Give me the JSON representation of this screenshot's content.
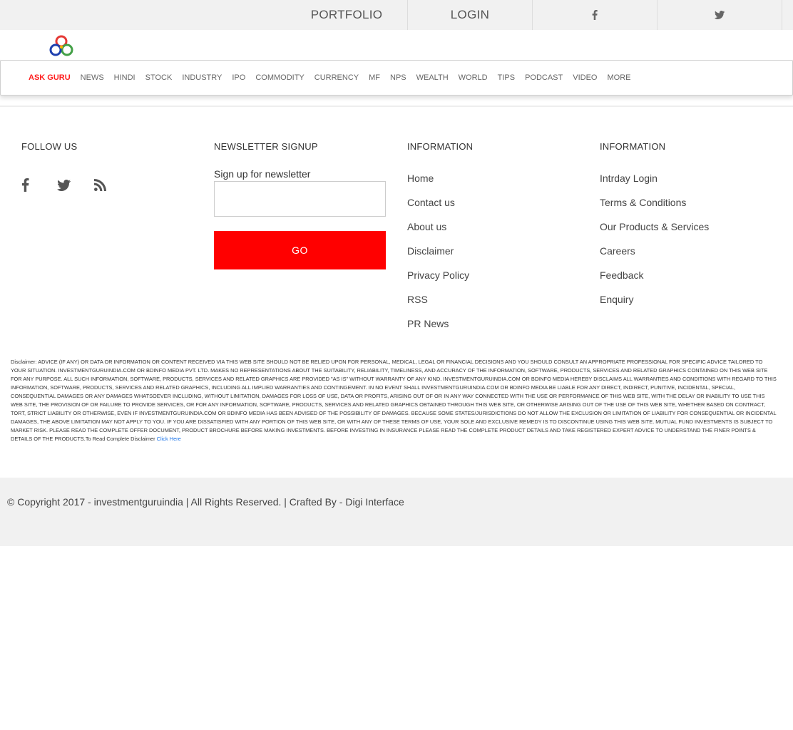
{
  "topbar": {
    "portfolio": "PORTFOLIO",
    "login": "LOGIN",
    "facebook_icon": "facebook-icon",
    "twitter_icon": "twitter-icon"
  },
  "nav": {
    "items": [
      "ASK GURU",
      "NEWS",
      "HINDI",
      "STOCK",
      "INDUSTRY",
      "IPO",
      "COMMODITY",
      "CURRENCY",
      "MF",
      "NPS",
      "WEALTH",
      "WORLD",
      "TIPS",
      "PODCAST",
      "VIDEO",
      "MORE"
    ],
    "active_color": "#ff1f1f"
  },
  "footer": {
    "follow": {
      "title": "FOLLOW US",
      "icons": [
        "facebook-icon",
        "twitter-icon",
        "rss-icon"
      ]
    },
    "newsletter": {
      "title": "NEWSLETTER SIGNUP",
      "label": "Sign up for newsletter",
      "input_value": "",
      "button": "GO",
      "button_color": "#ff0000"
    },
    "info1": {
      "title": "INFORMATION",
      "links": [
        "Home",
        "Contact us",
        "About us",
        "Disclaimer",
        "Privacy Policy",
        "RSS",
        "PR News"
      ]
    },
    "info2": {
      "title": "INFORMATION",
      "links": [
        "Intrday Login",
        "Terms & Conditions",
        "Our Products & Services",
        "Careers",
        "Feedback",
        "Enquiry"
      ]
    }
  },
  "disclaimer": {
    "text": "Disclaimer: ADVICE (IF ANY) OR DATA OR INFORMATION OR CONTENT RECEIVED VIA THIS WEB SITE SHOULD NOT BE RELIED UPON FOR PERSONAL, MEDICAL, LEGAL OR FINANCIAL DECISIONS AND YOU SHOULD CONSULT AN APPROPRIATE PROFESSIONAL FOR SPECIFIC ADVICE TAILORED TO YOUR SITUATION. INVESTMENTGURUINDIA.COM OR BDINFO MEDIA PVT. LTD. MAKES NO REPRESENTATIONS ABOUT THE SUITABILITY, RELIABILITY, TIMELINESS, AND ACCURACY OF THE INFORMATION, SOFTWARE, PRODUCTS, SERVICES AND RELATED GRAPHICS CONTAINED ON THIS WEB SITE FOR ANY PURPOSE. ALL SUCH INFORMATION, SOFTWARE, PRODUCTS, SERVICES AND RELATED GRAPHICS ARE PROVIDED \"AS IS\" WITHOUT WARRANTY OF ANY KIND. INVESTMENTGURUINDIA.COM OR BDINFO MEDIA HEREBY DISCLAIMS ALL WARRANTIES AND CONDITIONS WITH REGARD TO THIS INFORMATION, SOFTWARE, PRODUCTS, SERVICES AND RELATED GRAPHICS, INCLUDING ALL IMPLIED WARRANTIES AND CONTINGEMENT. IN NO EVENT SHALL INVESTMENTGURUINDIA.COM OR BDINFO MEDIA BE LIABLE FOR ANY DIRECT, INDIRECT, PUNITIVE, INCIDENTAL, SPECIAL, CONSEQUENTIAL DAMAGES OR ANY DAMAGES WHATSOEVER INCLUDING, WITHOUT LIMITATION, DAMAGES FOR LOSS OF USE, DATA OR PROFITS, ARISING OUT OF OR IN ANY WAY CONNECTED WITH THE USE OR PERFORMANCE OF THIS WEB SITE, WITH THE DELAY OR INABILITY TO USE THIS WEB SITE, THE PROVISION OF OR FAILURE TO PROVIDE SERVICES, OR FOR ANY INFORMATION, SOFTWARE, PRODUCTS, SERVICES AND RELATED GRAPHICS OBTAINED THROUGH THIS WEB SITE, OR OTHERWISE ARISING OUT OF THE USE OF THIS WEB SITE, WHETHER BASED ON CONTRACT, TORT, STRICT LIABILITY OR OTHERWISE, EVEN IF INVESTMENTGURUINDIA.COM OR BDINFO MEDIA HAS BEEN ADVISED OF THE POSSIBILITY OF DAMAGES. BECAUSE SOME STATES/JURISDICTIONS DO NOT ALLOW THE EXCLUSION OR LIMITATION OF LIABILITY FOR CONSEQUENTIAL OR INCIDENTAL DAMAGES, THE ABOVE LIMITATION MAY NOT APPLY TO YOU. IF YOU ARE DISSATISFIED WITH ANY PORTION OF THIS WEB SITE, OR WITH ANY OF THESE TERMS OF USE, YOUR SOLE AND EXCLUSIVE REMEDY IS TO DISCONTINUE USING THIS WEB SITE. MUTUAL FUND INVESTMENTS IS SUBJECT TO MARKET RISK. PLEASE READ THE COMPLETE OFFER DOCUMENT, PRODUCT BROCHURE BEFORE MAKING INVESTMENTS. BEFORE INVESTING IN INSURANCE PLEASE READ THE COMPLETE PRODUCT DETAILS AND TAKE REGISTERED EXPERT ADVICE TO UNDERSTAND THE FINER POINTS & DETAILS OF THE PRODUCTS.To Read Complete Disclaimer ",
    "link": "Click Here"
  },
  "copyright": "© Copyright 2017 - investmentguruindia | All Rights Reserved. | Crafted By - Digi Interface"
}
